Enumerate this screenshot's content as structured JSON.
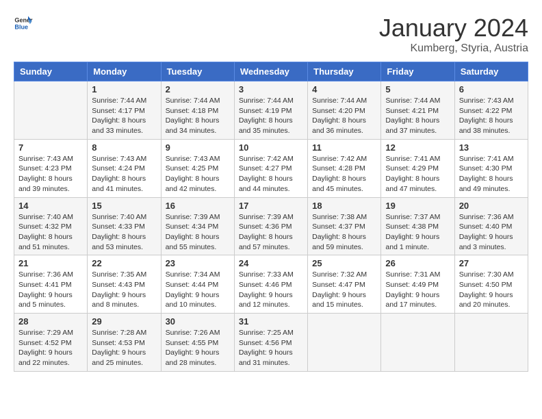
{
  "logo": {
    "text_general": "General",
    "text_blue": "Blue"
  },
  "title": "January 2024",
  "subtitle": "Kumberg, Styria, Austria",
  "days_of_week": [
    "Sunday",
    "Monday",
    "Tuesday",
    "Wednesday",
    "Thursday",
    "Friday",
    "Saturday"
  ],
  "weeks": [
    [
      {
        "day": "",
        "content": ""
      },
      {
        "day": "1",
        "content": "Sunrise: 7:44 AM\nSunset: 4:17 PM\nDaylight: 8 hours\nand 33 minutes."
      },
      {
        "day": "2",
        "content": "Sunrise: 7:44 AM\nSunset: 4:18 PM\nDaylight: 8 hours\nand 34 minutes."
      },
      {
        "day": "3",
        "content": "Sunrise: 7:44 AM\nSunset: 4:19 PM\nDaylight: 8 hours\nand 35 minutes."
      },
      {
        "day": "4",
        "content": "Sunrise: 7:44 AM\nSunset: 4:20 PM\nDaylight: 8 hours\nand 36 minutes."
      },
      {
        "day": "5",
        "content": "Sunrise: 7:44 AM\nSunset: 4:21 PM\nDaylight: 8 hours\nand 37 minutes."
      },
      {
        "day": "6",
        "content": "Sunrise: 7:43 AM\nSunset: 4:22 PM\nDaylight: 8 hours\nand 38 minutes."
      }
    ],
    [
      {
        "day": "7",
        "content": "Sunrise: 7:43 AM\nSunset: 4:23 PM\nDaylight: 8 hours\nand 39 minutes."
      },
      {
        "day": "8",
        "content": "Sunrise: 7:43 AM\nSunset: 4:24 PM\nDaylight: 8 hours\nand 41 minutes."
      },
      {
        "day": "9",
        "content": "Sunrise: 7:43 AM\nSunset: 4:25 PM\nDaylight: 8 hours\nand 42 minutes."
      },
      {
        "day": "10",
        "content": "Sunrise: 7:42 AM\nSunset: 4:27 PM\nDaylight: 8 hours\nand 44 minutes."
      },
      {
        "day": "11",
        "content": "Sunrise: 7:42 AM\nSunset: 4:28 PM\nDaylight: 8 hours\nand 45 minutes."
      },
      {
        "day": "12",
        "content": "Sunrise: 7:41 AM\nSunset: 4:29 PM\nDaylight: 8 hours\nand 47 minutes."
      },
      {
        "day": "13",
        "content": "Sunrise: 7:41 AM\nSunset: 4:30 PM\nDaylight: 8 hours\nand 49 minutes."
      }
    ],
    [
      {
        "day": "14",
        "content": "Sunrise: 7:40 AM\nSunset: 4:32 PM\nDaylight: 8 hours\nand 51 minutes."
      },
      {
        "day": "15",
        "content": "Sunrise: 7:40 AM\nSunset: 4:33 PM\nDaylight: 8 hours\nand 53 minutes."
      },
      {
        "day": "16",
        "content": "Sunrise: 7:39 AM\nSunset: 4:34 PM\nDaylight: 8 hours\nand 55 minutes."
      },
      {
        "day": "17",
        "content": "Sunrise: 7:39 AM\nSunset: 4:36 PM\nDaylight: 8 hours\nand 57 minutes."
      },
      {
        "day": "18",
        "content": "Sunrise: 7:38 AM\nSunset: 4:37 PM\nDaylight: 8 hours\nand 59 minutes."
      },
      {
        "day": "19",
        "content": "Sunrise: 7:37 AM\nSunset: 4:38 PM\nDaylight: 9 hours\nand 1 minute."
      },
      {
        "day": "20",
        "content": "Sunrise: 7:36 AM\nSunset: 4:40 PM\nDaylight: 9 hours\nand 3 minutes."
      }
    ],
    [
      {
        "day": "21",
        "content": "Sunrise: 7:36 AM\nSunset: 4:41 PM\nDaylight: 9 hours\nand 5 minutes."
      },
      {
        "day": "22",
        "content": "Sunrise: 7:35 AM\nSunset: 4:43 PM\nDaylight: 9 hours\nand 8 minutes."
      },
      {
        "day": "23",
        "content": "Sunrise: 7:34 AM\nSunset: 4:44 PM\nDaylight: 9 hours\nand 10 minutes."
      },
      {
        "day": "24",
        "content": "Sunrise: 7:33 AM\nSunset: 4:46 PM\nDaylight: 9 hours\nand 12 minutes."
      },
      {
        "day": "25",
        "content": "Sunrise: 7:32 AM\nSunset: 4:47 PM\nDaylight: 9 hours\nand 15 minutes."
      },
      {
        "day": "26",
        "content": "Sunrise: 7:31 AM\nSunset: 4:49 PM\nDaylight: 9 hours\nand 17 minutes."
      },
      {
        "day": "27",
        "content": "Sunrise: 7:30 AM\nSunset: 4:50 PM\nDaylight: 9 hours\nand 20 minutes."
      }
    ],
    [
      {
        "day": "28",
        "content": "Sunrise: 7:29 AM\nSunset: 4:52 PM\nDaylight: 9 hours\nand 22 minutes."
      },
      {
        "day": "29",
        "content": "Sunrise: 7:28 AM\nSunset: 4:53 PM\nDaylight: 9 hours\nand 25 minutes."
      },
      {
        "day": "30",
        "content": "Sunrise: 7:26 AM\nSunset: 4:55 PM\nDaylight: 9 hours\nand 28 minutes."
      },
      {
        "day": "31",
        "content": "Sunrise: 7:25 AM\nSunset: 4:56 PM\nDaylight: 9 hours\nand 31 minutes."
      },
      {
        "day": "",
        "content": ""
      },
      {
        "day": "",
        "content": ""
      },
      {
        "day": "",
        "content": ""
      }
    ]
  ]
}
